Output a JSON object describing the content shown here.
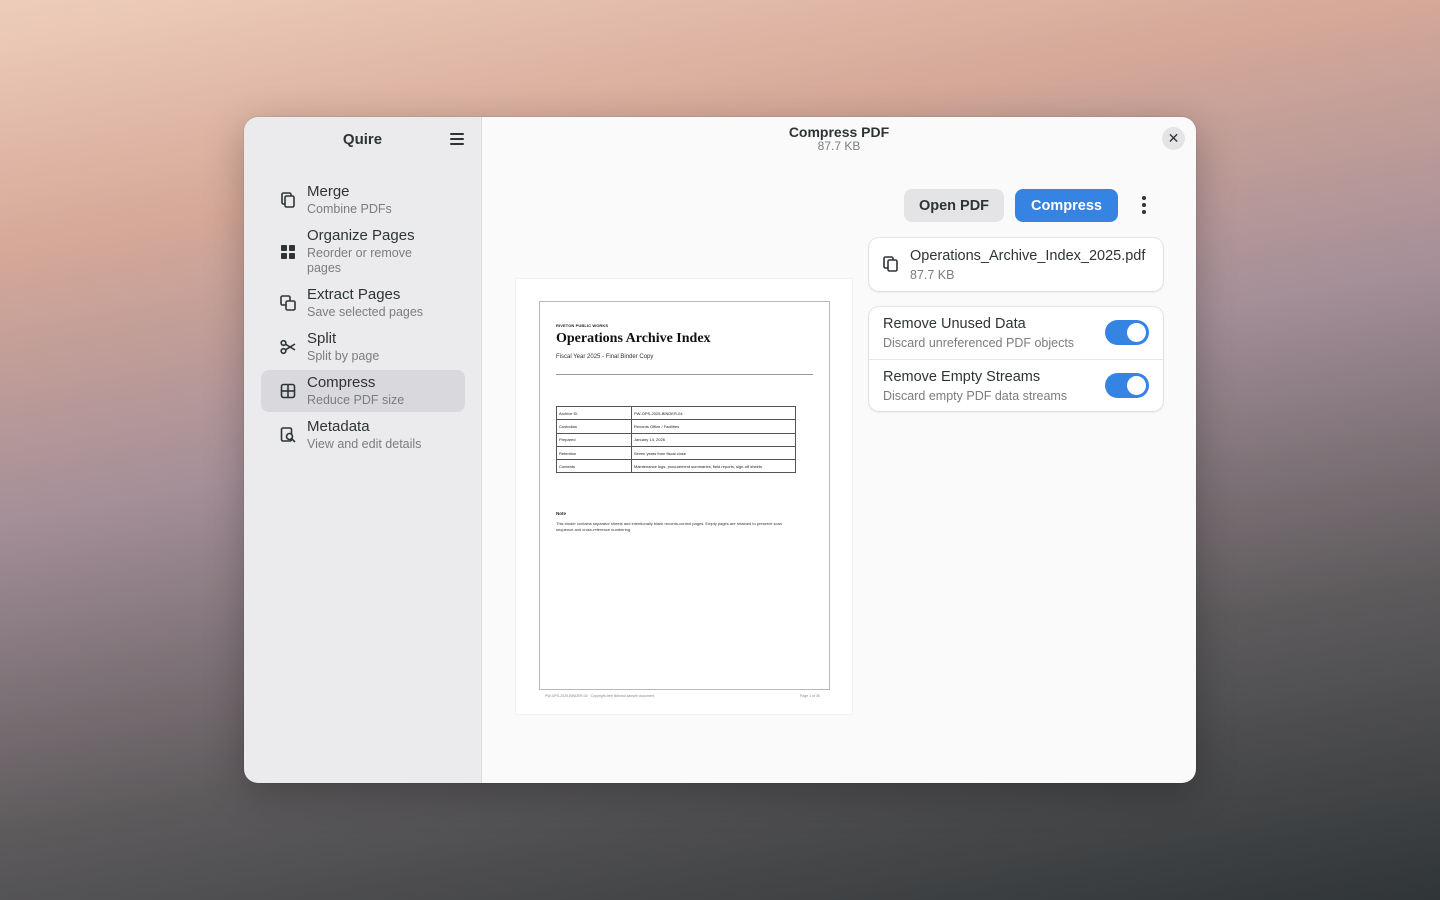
{
  "app": {
    "title": "Quire"
  },
  "sidebar": {
    "items": [
      {
        "title": "Merge",
        "subtitle": "Combine PDFs",
        "icon": "merge-icon"
      },
      {
        "title": "Organize Pages",
        "subtitle": "Reorder or remove pages",
        "icon": "grid-icon"
      },
      {
        "title": "Extract Pages",
        "subtitle": "Save selected pages",
        "icon": "extract-icon"
      },
      {
        "title": "Split",
        "subtitle": "Split by page",
        "icon": "scissors-icon"
      },
      {
        "title": "Compress",
        "subtitle": "Reduce PDF size",
        "icon": "compress-icon",
        "active": true
      },
      {
        "title": "Metadata",
        "subtitle": "View and edit details",
        "icon": "metadata-icon"
      }
    ]
  },
  "header": {
    "title": "Compress PDF",
    "subtitle": "87.7 KB",
    "close": "✕"
  },
  "toolbar": {
    "open_label": "Open PDF",
    "compress_label": "Compress"
  },
  "file": {
    "name": "Operations_Archive_Index_2025.pdf",
    "size": "87.7 KB"
  },
  "options": [
    {
      "title": "Remove Unused Data",
      "subtitle": "Discard unreferenced PDF objects",
      "enabled": true
    },
    {
      "title": "Remove Empty Streams",
      "subtitle": "Discard empty PDF data streams",
      "enabled": true
    }
  ],
  "document": {
    "org": "RIVETON PUBLIC WORKS",
    "title": "Operations Archive Index",
    "subtitle": "Fiscal Year 2025 - Final Binder Copy",
    "table": [
      {
        "key": "Archive ID",
        "value": "PW-OPS-2025-BINDER-04"
      },
      {
        "key": "Custodian",
        "value": "Records Office / Facilities"
      },
      {
        "key": "Prepared",
        "value": "January 14, 2026"
      },
      {
        "key": "Retention",
        "value": "Seven years from fiscal close"
      },
      {
        "key": "Contents",
        "value": "Maintenance logs, procurement summaries, field reports, sign-off sheets"
      }
    ],
    "note_heading": "Note",
    "note": "This binder contains separator sheets and intentionally blank records-control pages. Empty pages are retained to preserve scan sequence and cross-reference numbering.",
    "footer_left": "PW-OPS-2025-BINDER-04 · Copyright-free fictional sample document",
    "footer_right": "Page 1 of 36"
  },
  "colors": {
    "accent": "#3584e4",
    "sidebar_bg": "#ebebed",
    "active_item": "#d9d9dd"
  }
}
